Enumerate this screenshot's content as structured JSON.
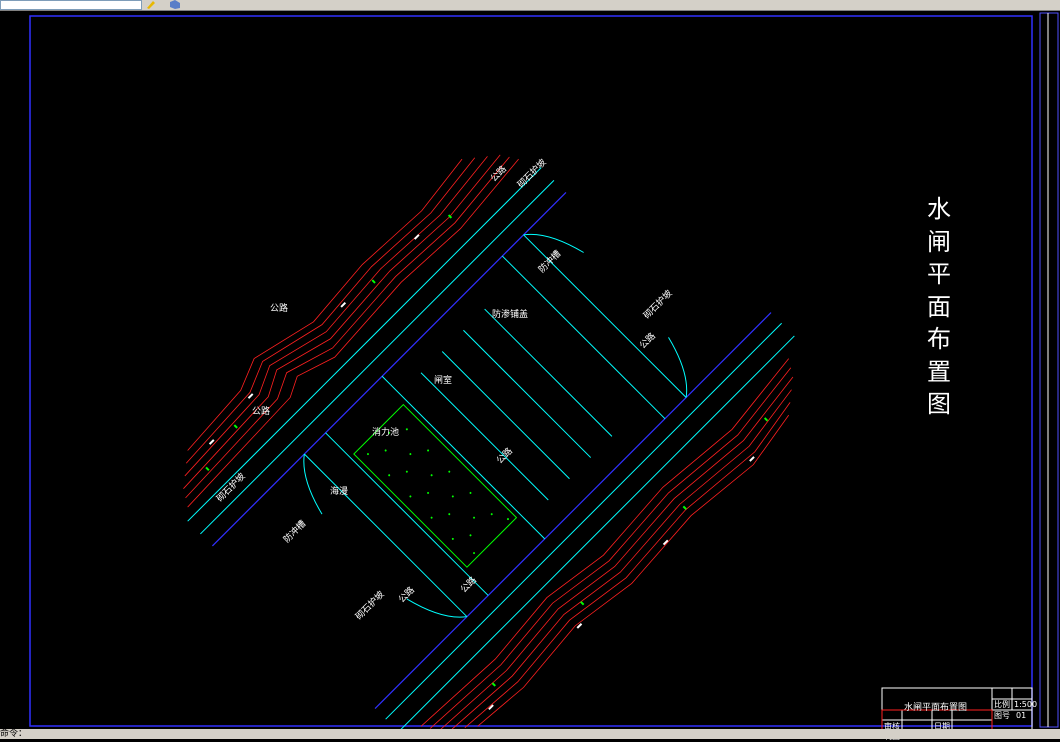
{
  "drawing": {
    "title_vertical": "水闸平面布置图",
    "labels": {
      "road": "公路",
      "revetment": "砌石护坡",
      "anti_scour": "防渗铺盖",
      "gate_room": "闸室",
      "stilling_basin": "消力池",
      "apron": "海漫",
      "riprap_strip": "防冲槽"
    }
  },
  "title_block": {
    "name": "水闸平面布置图",
    "scale_label": "比例",
    "scale_value": "1:500",
    "sheet_label": "图号",
    "sheet_value": "01",
    "reviewer_label": "审核",
    "date_label": "日期",
    "drafter_label": "制图"
  },
  "status": {
    "prompt": "命令："
  },
  "colors": {
    "background": "#000000",
    "road_lines": "#00ffff",
    "contours": "#ff2020",
    "frame": "#3030ff",
    "hatch": "#00ff00",
    "text": "#ffffff"
  }
}
